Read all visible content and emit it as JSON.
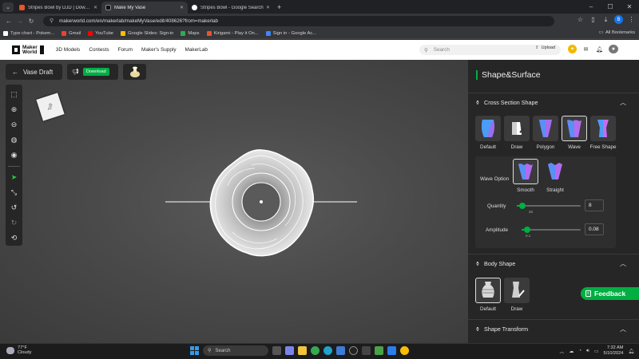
{
  "browser": {
    "tabs": [
      {
        "title": "Stripes Bowl by DJD | Downlo",
        "color": "#e8542c",
        "active": false
      },
      {
        "title": "Make My Vase",
        "color": "#111111",
        "active": true
      },
      {
        "title": "Stripes Bowl - Google Search",
        "color": "#ffffff",
        "active": false
      }
    ],
    "url": "makerworld.com/en/makerlab/makeMyVase/edit/408626?from=makerlab",
    "profile_initial": "B",
    "bookmarks": [
      {
        "label": "Type chart - Pokem...",
        "color": "#ffffff"
      },
      {
        "label": "Gmail",
        "color": "#ea4335"
      },
      {
        "label": "YouTube",
        "color": "#ff0000"
      },
      {
        "label": "Google Slides: Sign-in",
        "color": "#fbbc04"
      },
      {
        "label": "Maps",
        "color": "#34a853"
      },
      {
        "label": "Kirigami - Play it On...",
        "color": "#e8542c"
      },
      {
        "label": "Sign in - Google Ac...",
        "color": "#4285f4"
      }
    ],
    "all_bookmarks": "All Bookmarks"
  },
  "site": {
    "logo_line1": "Maker",
    "logo_line2": "World",
    "nav": [
      "3D Models",
      "Contests",
      "Forum",
      "Maker's Supply",
      "MakerLab"
    ],
    "search_placeholder": "Search",
    "upload_label": "Upload",
    "accent": "#00ae42"
  },
  "editor": {
    "back_label": "Vase Draft",
    "download_label": "Download",
    "view_cube_label": "Top"
  },
  "panel": {
    "title": "Shape&Surface",
    "cross_section": {
      "title": "Cross Section Shape",
      "options": [
        {
          "label": "Default",
          "selected": false
        },
        {
          "label": "Draw",
          "selected": false
        },
        {
          "label": "Polygon",
          "selected": false
        },
        {
          "label": "Wave",
          "selected": true
        },
        {
          "label": "Free Shape",
          "selected": false
        }
      ],
      "wave_option_label": "Wave Option",
      "wave_options": [
        {
          "label": "Smooth",
          "selected": true
        },
        {
          "label": "Straight",
          "selected": false
        }
      ],
      "quantity": {
        "label": "Quantity",
        "value": "8",
        "min_label": "20",
        "fraction": 0.05
      },
      "amplitude": {
        "label": "Amplitude",
        "value": "0.08",
        "min_label": "0.1",
        "fraction": 0.05
      }
    },
    "body_shape": {
      "title": "Body Shape",
      "options": [
        {
          "label": "Default",
          "selected": true
        },
        {
          "label": "Draw",
          "selected": false
        }
      ]
    },
    "shape_transform": {
      "title": "Shape Transform"
    }
  },
  "feedback_label": "Feedback",
  "taskbar": {
    "temperature": "77°F",
    "weather": "Cloudy",
    "search_placeholder": "Search",
    "time": "7:32 AM",
    "date": "5/10/2024"
  }
}
